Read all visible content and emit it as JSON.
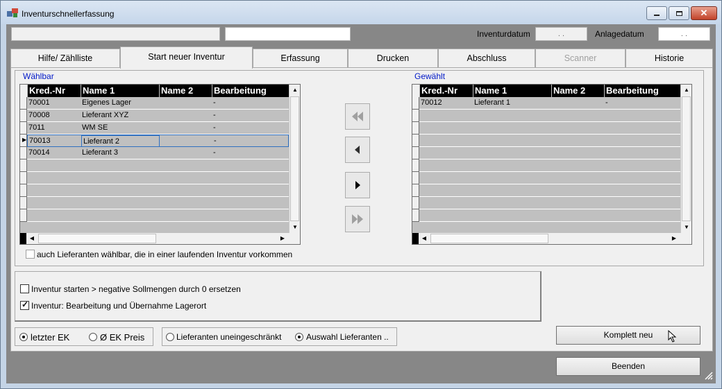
{
  "window": {
    "title": "Inventurschnellerfassung"
  },
  "header": {
    "field1": "",
    "field2": "",
    "inventurdatum_label": "Inventurdatum",
    "inventurdatum_value": ". .",
    "anlagedatum_label": "Anlagedatum",
    "anlagedatum_value": ". ."
  },
  "tabs": [
    {
      "label": "Hilfe/ Zählliste"
    },
    {
      "label": "Start neuer Inventur"
    },
    {
      "label": "Erfassung"
    },
    {
      "label": "Drucken"
    },
    {
      "label": "Abschluss"
    },
    {
      "label": "Scanner"
    },
    {
      "label": "Historie"
    }
  ],
  "left": {
    "title": "Wählbar",
    "columns": [
      "Kred.-Nr",
      "Name 1",
      "Name 2",
      "Bearbeitung"
    ],
    "rows": [
      [
        "70001",
        "Eigenes Lager",
        "",
        "-"
      ],
      [
        "70008",
        "Lieferant XYZ",
        "",
        "-"
      ],
      [
        "7011",
        "WM SE",
        "",
        "-"
      ],
      [
        "70013",
        "Lieferant 2",
        "",
        "-"
      ],
      [
        "70014",
        "Lieferant 3",
        "",
        "-"
      ],
      [
        "",
        "",
        "",
        ""
      ],
      [
        "",
        "",
        "",
        ""
      ],
      [
        "",
        "",
        "",
        ""
      ],
      [
        "",
        "",
        "",
        ""
      ],
      [
        "",
        "",
        "",
        ""
      ],
      [
        "",
        "",
        "",
        ""
      ]
    ]
  },
  "right": {
    "title": "Gewählt",
    "columns": [
      "Kred.-Nr",
      "Name 1",
      "Name 2",
      "Bearbeitung"
    ],
    "rows": [
      [
        "70012",
        "Lieferant 1",
        "",
        "-"
      ],
      [
        "",
        "",
        "",
        ""
      ],
      [
        "",
        "",
        "",
        ""
      ],
      [
        "",
        "",
        "",
        ""
      ],
      [
        "",
        "",
        "",
        ""
      ],
      [
        "",
        "",
        "",
        ""
      ],
      [
        "",
        "",
        "",
        ""
      ],
      [
        "",
        "",
        "",
        ""
      ],
      [
        "",
        "",
        "",
        ""
      ],
      [
        "",
        "",
        "",
        ""
      ],
      [
        "",
        "",
        "",
        ""
      ]
    ]
  },
  "options": {
    "auch_lieferanten": "auch Lieferanten wählbar, die in einer laufenden Inventur vorkommen",
    "negative": "Inventur starten > negative Sollmengen durch 0 ersetzen",
    "lagerort": "Inventur: Bearbeitung und Übernahme Lagerort",
    "letzter_ek": "letzter EK",
    "ek_preis": "Ø EK Preis",
    "uneingeschraenkt": "Lieferanten uneingeschränkt",
    "auswahl": "Auswahl Lieferanten .."
  },
  "buttons": {
    "komplett_neu": "Komplett neu",
    "beenden": "Beenden"
  },
  "colors": {
    "group_title": "#0018c8",
    "grid_header": "#000000",
    "grid_row": "#c0c0c0"
  }
}
